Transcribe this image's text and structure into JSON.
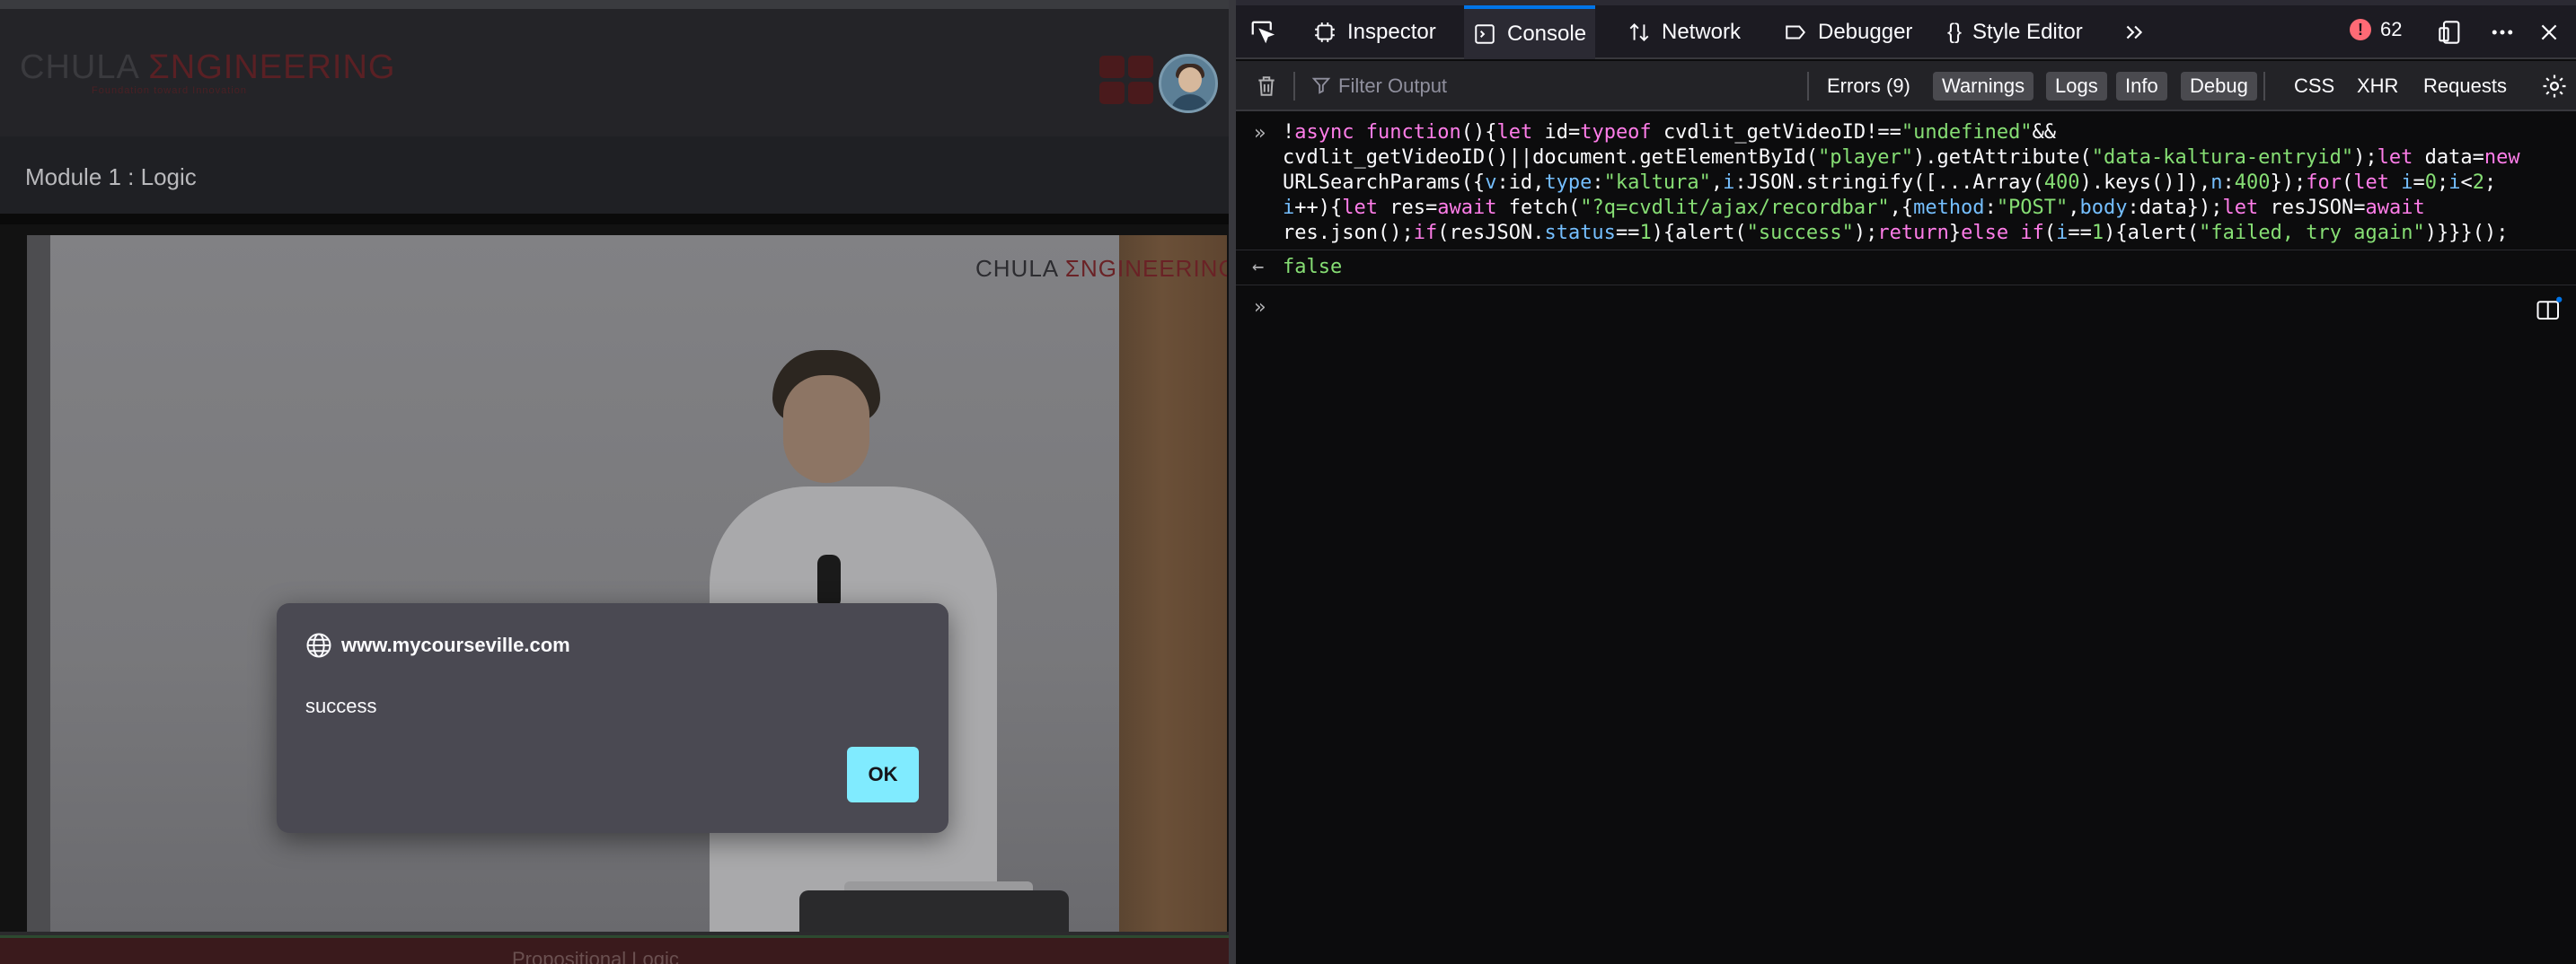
{
  "page": {
    "logo": {
      "prefix": "CHULA ",
      "accent": "ΣNGINEERING",
      "tagline": "Foundation toward Innovation"
    },
    "module_title": "Module 1 : Logic",
    "video": {
      "watermark_prefix": "CHULA ",
      "watermark_accent": "ΣNGINEERING"
    },
    "footer_text": "Propositional Logic"
  },
  "alert": {
    "origin": "www.mycourseville.com",
    "message": "success",
    "ok_label": "OK",
    "accent_color": "#80ebff"
  },
  "devtools": {
    "tabs": [
      {
        "label": "Inspector",
        "icon": "inspector-icon"
      },
      {
        "label": "Console",
        "icon": "console-icon",
        "selected": true
      },
      {
        "label": "Network",
        "icon": "network-icon"
      },
      {
        "label": "Debugger",
        "icon": "debugger-icon"
      },
      {
        "label": "Style Editor",
        "icon": "style-editor-icon"
      }
    ],
    "error_count": "62",
    "filter": {
      "placeholder": "Filter Output"
    },
    "levels": {
      "errors": "Errors (9)",
      "warnings": "Warnings",
      "logs": "Logs",
      "info": "Info",
      "debug": "Debug"
    },
    "categories": {
      "css": "CSS",
      "xhr": "XHR",
      "requests": "Requests"
    },
    "console": {
      "input_code": "!async function(){let id=typeof cvdlit_getVideoID!==\"undefined\"&&\ncvdlit_getVideoID()||document.getElementById(\"player\").getAttribute(\"data-kaltura-entryid\");let data=new\nURLSearchParams({v:id,type:\"kaltura\",i:JSON.stringify([...Array(400).keys()]),n:400});for(let i=0;i<2;\ni++){let res=await fetch(\"?q=cvdlit/ajax/recordbar\",{method:\"POST\",body:data});let resJSON=await\nres.json();if(resJSON.status==1){alert(\"success\");return}else if(i==1){alert(\"failed, try again\")}}}();",
      "result": "false"
    },
    "colors": {
      "selected_tab": "#0074e8",
      "keyword": "#ff7de9",
      "string": "#86de74",
      "identifier": "#75bfff"
    }
  }
}
